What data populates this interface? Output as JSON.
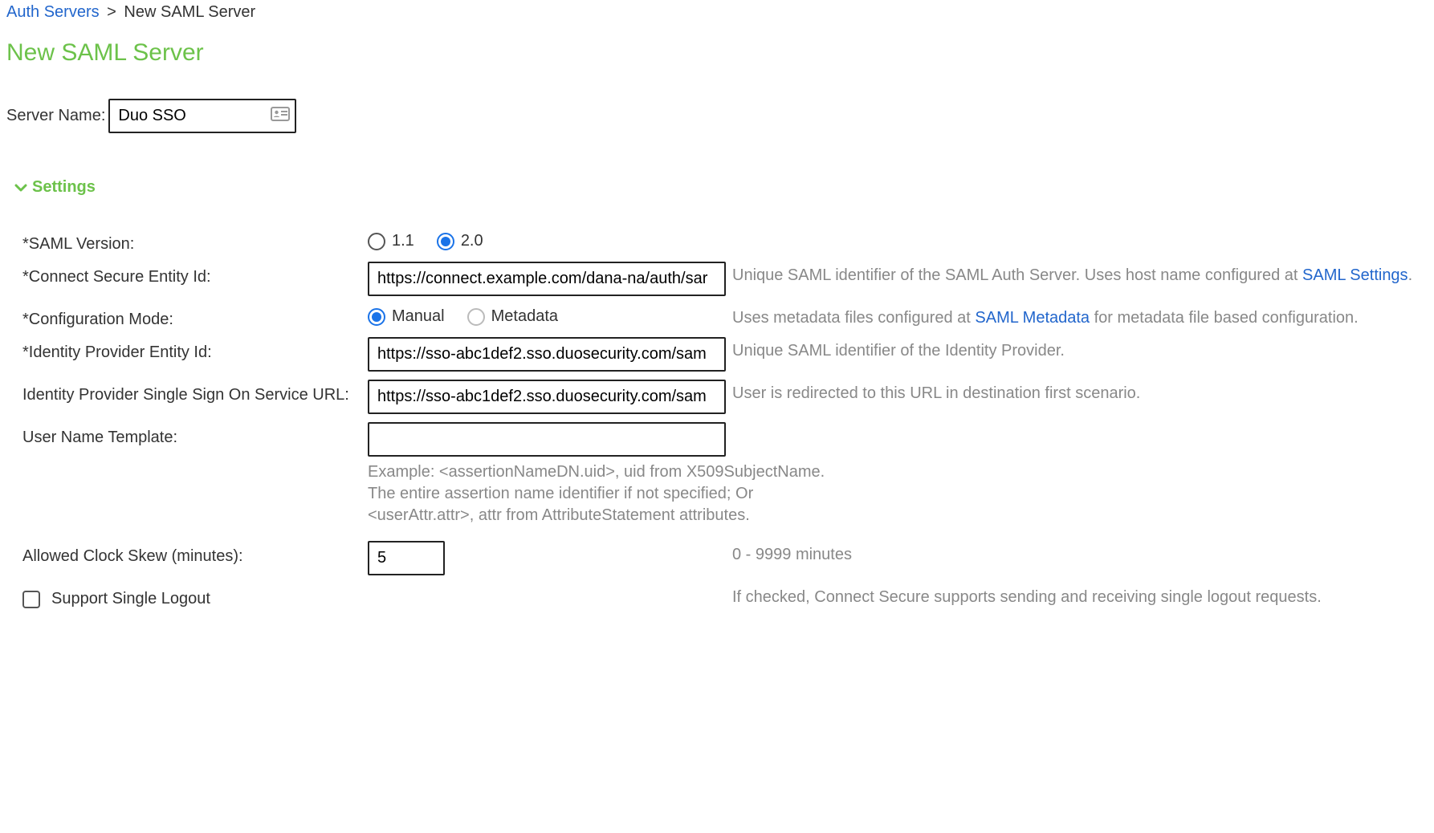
{
  "breadcrumb": {
    "parent": "Auth Servers",
    "separator": ">",
    "current": "New SAML Server"
  },
  "page_title": "New SAML Server",
  "server_name": {
    "label": "Server Name:",
    "value": "Duo SSO"
  },
  "settings_section": {
    "title": "Settings"
  },
  "fields": {
    "saml_version": {
      "label": "*SAML Version:",
      "options": [
        {
          "label": "1.1",
          "checked": false
        },
        {
          "label": "2.0",
          "checked": true
        }
      ]
    },
    "entity_id": {
      "label": "*Connect Secure Entity Id:",
      "value": "https://connect.example.com/dana-na/auth/sar",
      "help_prefix": "Unique SAML identifier of the SAML Auth Server. Uses host name configured at ",
      "help_link": "SAML Settings",
      "help_suffix": "."
    },
    "config_mode": {
      "label": "*Configuration Mode:",
      "options": [
        {
          "label": "Manual",
          "checked": true
        },
        {
          "label": "Metadata",
          "checked": false
        }
      ],
      "help_prefix": "Uses metadata files configured at ",
      "help_link": "SAML Metadata",
      "help_suffix": " for metadata file based configuration."
    },
    "idp_entity_id": {
      "label": "*Identity Provider Entity Id:",
      "value": "https://sso-abc1def2.sso.duosecurity.com/sam",
      "help": "Unique SAML identifier of the Identity Provider."
    },
    "idp_sso_url": {
      "label": "Identity Provider Single Sign On Service URL:",
      "value": "https://sso-abc1def2.sso.duosecurity.com/sam",
      "help": "User is redirected to this URL in destination first scenario."
    },
    "username_template": {
      "label": "User Name Template:",
      "value": "",
      "help_lines": [
        "Example: <assertionNameDN.uid>, uid from X509SubjectName.",
        "The entire assertion name identifier if not specified; Or",
        "<userAttr.attr>, attr from AttributeStatement attributes."
      ]
    },
    "clock_skew": {
      "label": "Allowed Clock Skew (minutes):",
      "value": "5",
      "help": "0 - 9999 minutes"
    },
    "support_slo": {
      "label": "Support Single Logout",
      "checked": false,
      "help": "If checked, Connect Secure supports sending and receiving single logout requests."
    }
  }
}
